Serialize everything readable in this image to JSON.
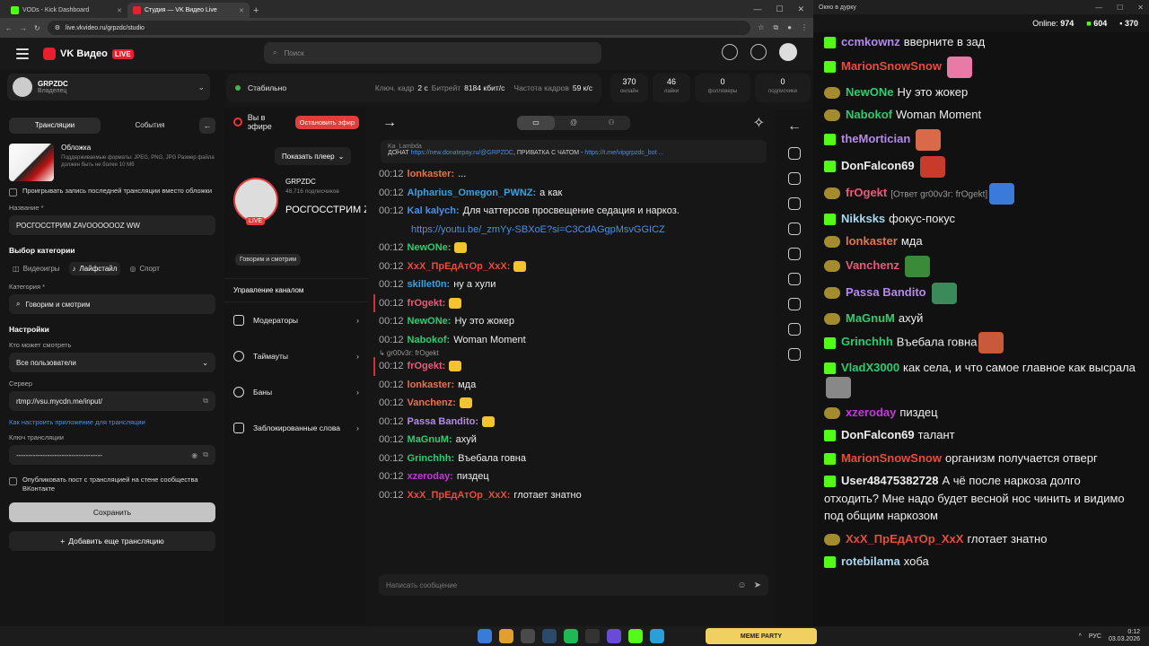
{
  "browser": {
    "tabs": [
      {
        "label": "VODs - Kick Dashboard",
        "color": "#53fc18"
      },
      {
        "label": "Студия — VK Видео Live",
        "color": "#e91e2f"
      }
    ],
    "url": "live.vkvideo.ru/grpzdc/studio"
  },
  "vk": {
    "logo": "VK Видео",
    "live_badge": "LIVE",
    "search_placeholder": "Поиск",
    "owner": {
      "name": "GRPZDC",
      "role": "Владелец"
    },
    "tabs": [
      "Трансляции",
      "События"
    ],
    "cover": {
      "title": "Обложка",
      "desc": "Поддерживаемые форматы: JPEG, PNG, JPG Размер файла должен быть не более 10 Мб"
    },
    "replay_checkbox": "Проигрывать запись последней трансляции вместо обложки",
    "name_label": "Название *",
    "name_value": "РОСГОССТРИМ ZAVOOOOOOZ WW",
    "category_section": "Выбор категории",
    "cats": [
      "Видеоигры",
      "Лайфстайл",
      "Спорт"
    ],
    "category_label": "Категория *",
    "category_value": "Говорим и смотрим",
    "settings": "Настройки",
    "who_label": "Кто может смотреть",
    "who_value": "Все пользователи",
    "server_label": "Сервер",
    "server_value": "rtmp://vsu.mycdn.me/input/",
    "setup_link": "Как настроить приложение для трансляции",
    "key_label": "Ключ трансляции",
    "key_value": "------------------------------------",
    "publish_checkbox": "Опубликовать пост с трансляцией на стене сообщества ВКонтакте",
    "save": "Сохранить",
    "add": "Добавить еще трансляцию",
    "status": {
      "state": "Стабильно",
      "keyframe_label": "Ключ. кадр",
      "keyframe": "2 с",
      "bitrate_label": "Битрейт",
      "bitrate": "8184 кбит/с",
      "fps_label": "Частота кадров",
      "fps": "59 к/с"
    },
    "stats": [
      {
        "v": "370",
        "k": "онлайн"
      },
      {
        "v": "46",
        "k": "лайки"
      },
      {
        "v": "0",
        "k": "фолловеры"
      },
      {
        "v": "0",
        "k": "подписчики"
      }
    ],
    "onair": "Вы в эфире",
    "stop": "Остановить эфир",
    "show_player": "Показать плеер",
    "channel": "GRPZDC",
    "subs": "48,716 подписчиков",
    "stream_title": "РОСГОССТРИМ ZAVOOOOOOZ WW",
    "stream_live": "LIVE",
    "chip": "Говорим и смотрим",
    "mgmt_header": "Управление каналом",
    "mgmt": [
      "Модераторы",
      "Таймауты",
      "Баны",
      "Заблокированные слова"
    ],
    "pinned": {
      "author": "Ka_Lambda",
      "text": "ДОНАТ ",
      "url": "https://new.donatepay.ru/@GRPZDC",
      "rest": ", ПРИВАТКА С ЧАТОМ - ",
      "url2": "https://t.me/vipgrpzdc_bot ..."
    },
    "chat_placeholder": "Написать сообщение",
    "chat": [
      {
        "ts": "00:12",
        "u": "lonkaster:",
        "c": "#e8734a",
        "t": "..."
      },
      {
        "ts": "00:12",
        "u": "Alpharius_Omegon_PWNZ:",
        "c": "#3aa0e0",
        "t": "а как"
      },
      {
        "ts": "00:12",
        "u": "Kal kalych:",
        "c": "#4a8fe8",
        "t": "Для чаттерсов просвещение седация и наркоз."
      },
      {
        "ts": "",
        "u": "",
        "c": "#4a8fe8",
        "t": "https://youtu.be/_zmYy-SBXoE?si=C3CdAGgpMsvGGICZ",
        "link": true
      },
      {
        "ts": "00:12",
        "u": "NewONe:",
        "c": "#2ecc71",
        "t": ""
      },
      {
        "ts": "00:12",
        "u": "XxX_ПрЕдАтОр_XxX:",
        "c": "#e74c3c",
        "t": ""
      },
      {
        "ts": "00:12",
        "u": "skillet0n:",
        "c": "#3aa0e0",
        "t": "ну а хули"
      },
      {
        "ts": "00:12",
        "u": "frOgekt:",
        "c": "#e85a7a",
        "t": "",
        "hl": true
      },
      {
        "ts": "00:12",
        "u": "NewONe:",
        "c": "#2ecc71",
        "t": "Ну это жокер"
      },
      {
        "ts": "00:12",
        "u": "Nabokof:",
        "c": "#2ecc71",
        "t": "Woman Moment"
      },
      {
        "reply": "↳ gr00v3r: frOgekt"
      },
      {
        "ts": "00:12",
        "u": "frOgekt:",
        "c": "#e85a7a",
        "t": "",
        "hl": true
      },
      {
        "ts": "00:12",
        "u": "lonkaster:",
        "c": "#e8734a",
        "t": "мда"
      },
      {
        "ts": "00:12",
        "u": "Vanchenz:",
        "c": "#e8734a",
        "t": ""
      },
      {
        "ts": "00:12",
        "u": "Passa Bandito:",
        "c": "#b48ae8",
        "t": ""
      },
      {
        "ts": "00:12",
        "u": "MaGnuM:",
        "c": "#2ecc71",
        "t": "ахуй"
      },
      {
        "ts": "00:12",
        "u": "Grinchhh:",
        "c": "#2ecc71",
        "t": "Въебала говна"
      },
      {
        "ts": "00:12",
        "u": "xzeroday:",
        "c": "#c03ad8",
        "t": "пиздец"
      },
      {
        "ts": "00:12",
        "u": "XxX_ПрЕдАтОр_XxX:",
        "c": "#e74c3c",
        "t": "глотает знатно"
      }
    ]
  },
  "kick": {
    "title": "Окно в дурку",
    "online_label": "Online:",
    "online": "974",
    "followers": "604",
    "viewers": "370",
    "msgs": [
      {
        "u": "ccmkownz",
        "c": "#b48ae8",
        "t": "вверните в зад",
        "b": "badge"
      },
      {
        "u": "MarionSnowSnow",
        "c": "#e74c3c",
        "t": "",
        "b": "badge",
        "em": "#e87aa8"
      },
      {
        "u": "NewONe",
        "c": "#2ecc71",
        "t": "Ну это жокер",
        "b": "av"
      },
      {
        "u": "Nabokof",
        "c": "#2ecc71",
        "t": "Woman Moment",
        "b": "av"
      },
      {
        "u": "theMortician",
        "c": "#b48ae8",
        "t": "",
        "b": "badge",
        "em": "#d86a4a"
      },
      {
        "u": "DonFalcon69",
        "c": "#eeeeee",
        "t": "",
        "b": "badge",
        "em": "#c83a2a"
      },
      {
        "u": "frOgekt",
        "c": "#e85a7a",
        "t": "",
        "b": "av",
        "rp": "[Ответ gr00v3r: frOgekt]",
        "em": "#3a7ad8"
      },
      {
        "u": "Nikksks",
        "c": "#a8d8f0",
        "t": "фокус-покус",
        "b": "badge"
      },
      {
        "u": "lonkaster",
        "c": "#e8734a",
        "t": "мда",
        "b": "av"
      },
      {
        "u": "Vanchenz",
        "c": "#e85a7a",
        "t": "",
        "b": "av",
        "em": "#3a8a3a"
      },
      {
        "u": "Passa Bandito",
        "c": "#b48ae8",
        "t": "",
        "b": "av",
        "em": "#3a8a5a"
      },
      {
        "u": "MaGnuM",
        "c": "#2ecc71",
        "t": "ахуй",
        "b": "av"
      },
      {
        "u": "Grinchhh",
        "c": "#2ecc71",
        "t": "Въебала говна",
        "b": "badge",
        "em": "#c85a3a"
      },
      {
        "u": "VladX3000",
        "c": "#2ecc71",
        "t": "как села, и что самое главное как высрала",
        "b": "badge",
        "em": "#888888"
      },
      {
        "u": "xzeroday",
        "c": "#c03ad8",
        "t": "пиздец",
        "b": "av"
      },
      {
        "u": "DonFalcon69",
        "c": "#eeeeee",
        "t": "талант",
        "b": "badge"
      },
      {
        "u": "MarionSnowSnow",
        "c": "#e74c3c",
        "t": "организм получается отверг",
        "b": "badge"
      },
      {
        "u": "User48475382728",
        "c": "#eeeeee",
        "t": "А чё после наркоза долго отходить? Мне надо будет весной нос чинить и видимо под общим наркозом",
        "b": "badge"
      },
      {
        "u": "XxX_ПрЕдАтОр_XxX",
        "c": "#e74c3c",
        "t": "глотает знатно",
        "b": "av"
      },
      {
        "u": "rotebilama",
        "c": "#a8d8f0",
        "t": "хоба",
        "b": "badge"
      }
    ]
  },
  "taskbar": {
    "meme": "MEME PARTY",
    "time": "0:12",
    "date": "03.03.2026",
    "lang": "РУС"
  }
}
